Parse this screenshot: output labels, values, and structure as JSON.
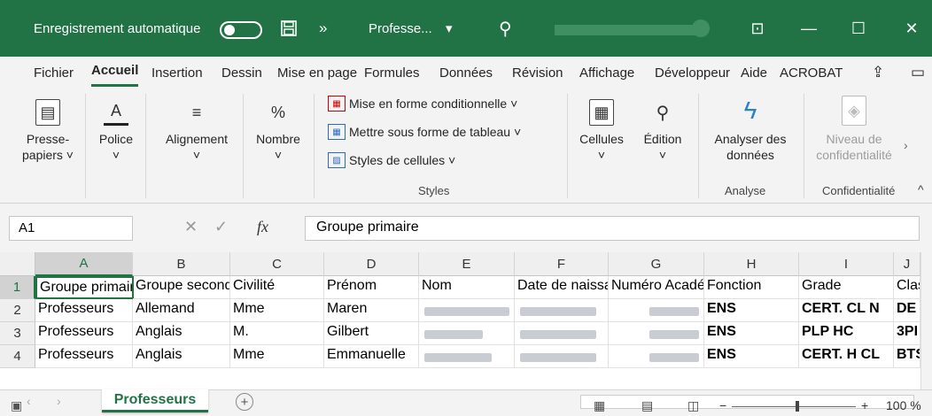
{
  "titlebar": {
    "autosave_label": "Enregistrement automatique",
    "save_icon": "save-icon",
    "more_symbol": "»",
    "doc_name": "Professe...",
    "dropdown_symbol": "▾",
    "search_symbol": "⚲",
    "ribbon_display_symbol": "⊡",
    "minimize_symbol": "—",
    "maximize_symbol": "☐",
    "close_symbol": "✕"
  },
  "menu": {
    "items": [
      "Fichier",
      "Accueil",
      "Insertion",
      "Dessin",
      "Mise en page",
      "Formules",
      "Données",
      "Révision",
      "Affichage",
      "Développeur",
      "Aide",
      "ACROBAT"
    ],
    "share_symbol": "⇪",
    "comment_symbol": "▭"
  },
  "ribbon": {
    "clipboard_label": "Presse-papiers ˅",
    "font_label": "Police",
    "alignment_label": "Alignement",
    "number_label": "Nombre",
    "conditional_format": "Mise en forme conditionnelle ˅",
    "table_format": "Mettre sous forme de tableau ˅",
    "cell_styles": "Styles de cellules ˅",
    "styles_caption": "Styles",
    "cells_label": "Cellules",
    "editing_label": "Édition",
    "analyze_label": "Analyser des données",
    "analyze_caption": "Analyse",
    "sensitivity_label": "Niveau de confidentialité",
    "sensitivity_caption": "Confidentialité",
    "chevron": "˅",
    "collapse_symbol": "^",
    "scroll_right": "›"
  },
  "formula": {
    "name_box": "A1",
    "fx_label": "fx",
    "cancel_symbol": "✕",
    "enter_symbol": "✓",
    "value": "Groupe primaire"
  },
  "grid": {
    "columns": [
      "A",
      "B",
      "C",
      "D",
      "E",
      "F",
      "G",
      "H",
      "I",
      "J"
    ],
    "rows": [
      "1",
      "2",
      "3",
      "4"
    ],
    "cells": [
      [
        "Groupe primaire",
        "Groupe secondaire",
        "Civilité",
        "Prénom",
        "Nom",
        "Date de naissance",
        "Numéro Académique",
        "Fonction",
        "Grade",
        "Classe"
      ],
      [
        "Professeurs",
        "Allemand",
        "Mme",
        "Maren",
        "",
        "",
        "",
        "ENS",
        "CERT. CL N",
        "DE"
      ],
      [
        "Professeurs",
        "Anglais",
        "M.",
        "Gilbert",
        "",
        "",
        "",
        "ENS",
        "PLP HC",
        "3PI"
      ],
      [
        "Professeurs",
        "Anglais",
        "Mme",
        "Emmanuelle",
        "",
        "",
        "",
        "ENS",
        "CERT. H CL",
        "BTS"
      ]
    ]
  },
  "tabs": {
    "active_sheet": "Professeurs",
    "add_symbol": "+"
  },
  "status": {
    "zoom": "100 %",
    "minus": "−",
    "plus": "+"
  }
}
